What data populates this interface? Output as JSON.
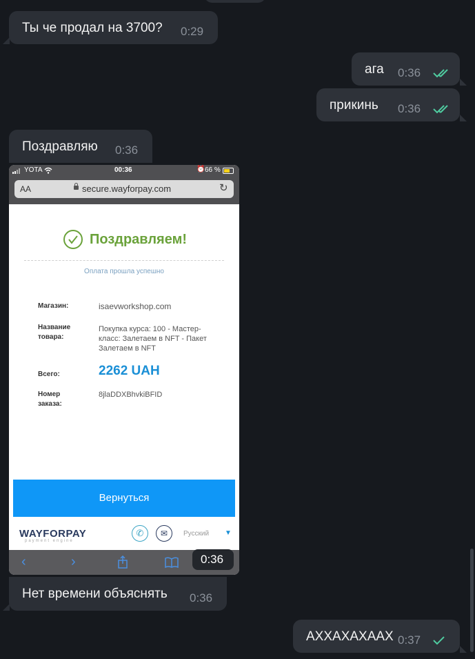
{
  "messages": [
    {
      "text": "Ты че продал на 3700?",
      "time": "0:29",
      "direction": "in"
    },
    {
      "text": "ага",
      "time": "0:36",
      "direction": "out",
      "status": "read"
    },
    {
      "text": "прикинь",
      "time": "0:36",
      "direction": "out",
      "status": "read"
    },
    {
      "text": "Поздравляю",
      "time": "0:36",
      "direction": "in"
    },
    {
      "text": "Нет времени объяснять",
      "time": "0:36",
      "direction": "in"
    },
    {
      "text": "АХХАХАХААХ",
      "time": "0:37",
      "direction": "out",
      "status": "sent"
    }
  ],
  "photo": {
    "time": "0:36",
    "status_bar": {
      "carrier": "YOTA",
      "clock": "00:36",
      "battery": "66 %"
    },
    "url_bar": {
      "text_size": "AA",
      "url": "secure.wayforpay.com"
    },
    "page": {
      "success_title": "Поздравляем!",
      "success_subtitle": "Оплата прошла успешно",
      "rows": {
        "shop_label": "Магазин:",
        "shop_value": "isaevworkshop.com",
        "product_label_1": "Название",
        "product_label_2": "товара:",
        "product_value_1": "Покупка курса: 100 - Мастер-",
        "product_value_2": "класс: Залетаем в NFT - Пакет",
        "product_value_3": "Залетаем в NFT",
        "total_label": "Всего:",
        "total_value": "2262 UAH",
        "order_label_1": "Номер",
        "order_label_2": "заказа:",
        "order_value": "8jlaDDXBhvkiBFID"
      },
      "return_button": "Вернуться",
      "brand_main": "WAYFORPAY",
      "brand_sub": "payment engine",
      "language": "Русский"
    }
  },
  "colors": {
    "background": "#16191e",
    "bubble": "#2b2f36",
    "check": "#4fcca0",
    "success_green": "#6aa23a",
    "total_blue": "#1a8fd6",
    "button_blue": "#0f97f7"
  }
}
